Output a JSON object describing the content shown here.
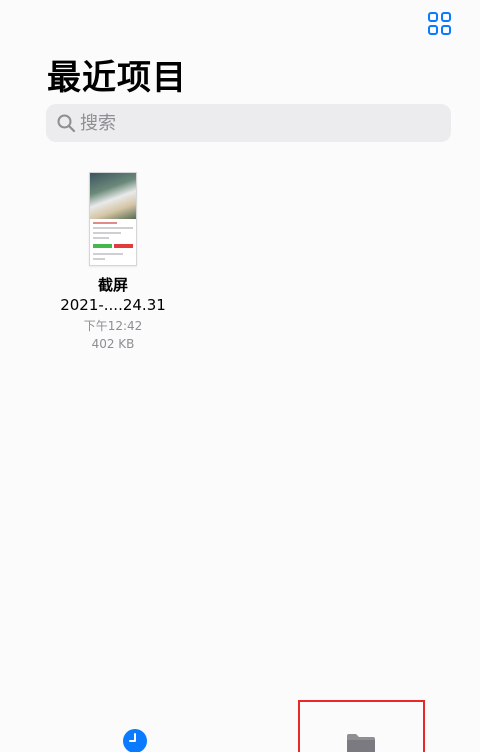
{
  "header": {
    "view_toggle_icon": "grid-icon",
    "title": "最近项目"
  },
  "search": {
    "placeholder": "搜索",
    "icon": "search-icon"
  },
  "files": [
    {
      "name_line1": "截屏",
      "name_line2": "2021-....24.31",
      "time": "下午12:42",
      "size": "402 KB"
    }
  ],
  "tabbar": {
    "tabs": [
      {
        "id": "recents",
        "icon": "clock-icon",
        "color": "#0a7aff",
        "selected": true
      },
      {
        "id": "browse",
        "icon": "folder-icon",
        "color": "#8e8e93",
        "highlighted": true
      }
    ]
  },
  "colors": {
    "accent": "#0a7aff",
    "highlight_box": "#e8282b"
  }
}
